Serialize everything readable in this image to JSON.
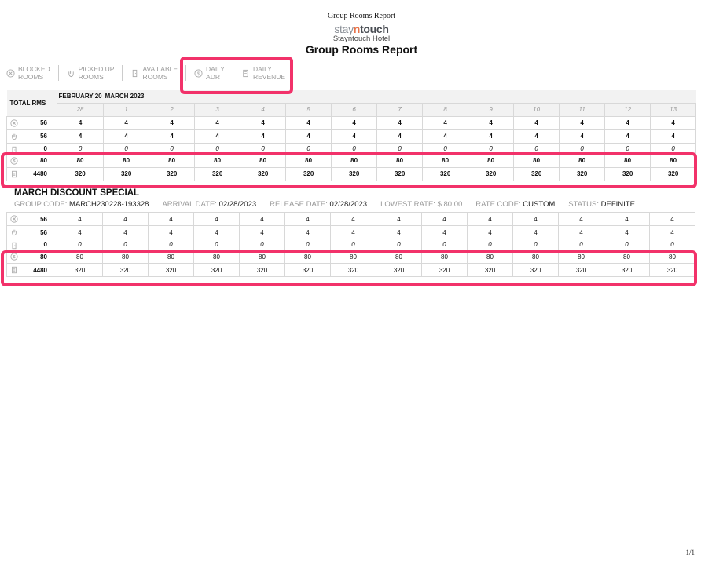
{
  "print_header": "Group Rooms Report",
  "brand": {
    "logo_stay": "stay",
    "logo_n": "n",
    "logo_touch": "touch",
    "hotel": "Stayntouch Hotel",
    "title": "Group Rooms Report"
  },
  "legend": [
    {
      "icon": "blocked-icon",
      "line1": "BLOCKED",
      "line2": "ROOMS"
    },
    {
      "icon": "hand-icon",
      "line1": "PICKED UP",
      "line2": "ROOMS"
    },
    {
      "icon": "door-icon",
      "line1": "AVAILABLE",
      "line2": "ROOMS"
    },
    {
      "icon": "dollar-icon",
      "line1": "DAILY",
      "line2": "ADR"
    },
    {
      "icon": "receipt-icon",
      "line1": "DAILY",
      "line2": "REVENUE"
    }
  ],
  "summary": {
    "total_label": "TOTAL RMS",
    "months": [
      "FEBRUARY 20",
      "MARCH 2023"
    ],
    "dates": [
      "28",
      "1",
      "2",
      "3",
      "4",
      "5",
      "6",
      "7",
      "8",
      "9",
      "10",
      "11",
      "12",
      "13"
    ],
    "rows": [
      {
        "icon": "blocked-icon",
        "total": "56",
        "values": [
          "4",
          "4",
          "4",
          "4",
          "4",
          "4",
          "4",
          "4",
          "4",
          "4",
          "4",
          "4",
          "4",
          "4"
        ]
      },
      {
        "icon": "hand-icon",
        "total": "56",
        "values": [
          "4",
          "4",
          "4",
          "4",
          "4",
          "4",
          "4",
          "4",
          "4",
          "4",
          "4",
          "4",
          "4",
          "4"
        ]
      },
      {
        "icon": "door-icon",
        "total": "0",
        "values": [
          "0",
          "0",
          "0",
          "0",
          "0",
          "0",
          "0",
          "0",
          "0",
          "0",
          "0",
          "0",
          "0",
          "0"
        ]
      },
      {
        "icon": "dollar-icon",
        "total": "80",
        "values": [
          "80",
          "80",
          "80",
          "80",
          "80",
          "80",
          "80",
          "80",
          "80",
          "80",
          "80",
          "80",
          "80",
          "80"
        ]
      },
      {
        "icon": "receipt-icon",
        "total": "4480",
        "values": [
          "320",
          "320",
          "320",
          "320",
          "320",
          "320",
          "320",
          "320",
          "320",
          "320",
          "320",
          "320",
          "320",
          "320"
        ]
      }
    ]
  },
  "group": {
    "name": "MARCH DISCOUNT SPECIAL",
    "meta": [
      {
        "label": "GROUP CODE: ",
        "value": "MARCH230228-193328"
      },
      {
        "label": "ARRIVAL DATE: ",
        "value": "02/28/2023"
      },
      {
        "label": "RELEASE DATE: ",
        "value": "02/28/2023"
      },
      {
        "label": "LOWEST RATE: $ 80.00",
        "value": ""
      },
      {
        "label": "RATE CODE: ",
        "value": "CUSTOM"
      },
      {
        "label": "STATUS: ",
        "value": "DEFINITE"
      }
    ],
    "rows": [
      {
        "icon": "blocked-icon",
        "total": "56",
        "values": [
          "4",
          "4",
          "4",
          "4",
          "4",
          "4",
          "4",
          "4",
          "4",
          "4",
          "4",
          "4",
          "4",
          "4"
        ]
      },
      {
        "icon": "hand-icon",
        "total": "56",
        "values": [
          "4",
          "4",
          "4",
          "4",
          "4",
          "4",
          "4",
          "4",
          "4",
          "4",
          "4",
          "4",
          "4",
          "4"
        ]
      },
      {
        "icon": "door-icon",
        "total": "0",
        "values": [
          "0",
          "0",
          "0",
          "0",
          "0",
          "0",
          "0",
          "0",
          "0",
          "0",
          "0",
          "0",
          "0",
          "0"
        ]
      },
      {
        "icon": "dollar-icon",
        "total": "80",
        "values": [
          "80",
          "80",
          "80",
          "80",
          "80",
          "80",
          "80",
          "80",
          "80",
          "80",
          "80",
          "80",
          "80",
          "80"
        ]
      },
      {
        "icon": "receipt-icon",
        "total": "4480",
        "values": [
          "320",
          "320",
          "320",
          "320",
          "320",
          "320",
          "320",
          "320",
          "320",
          "320",
          "320",
          "320",
          "320",
          "320"
        ]
      }
    ]
  },
  "colors": {
    "highlight": "#f2326a",
    "header_bg": "#f2f2f2"
  },
  "page_number": "1/1"
}
